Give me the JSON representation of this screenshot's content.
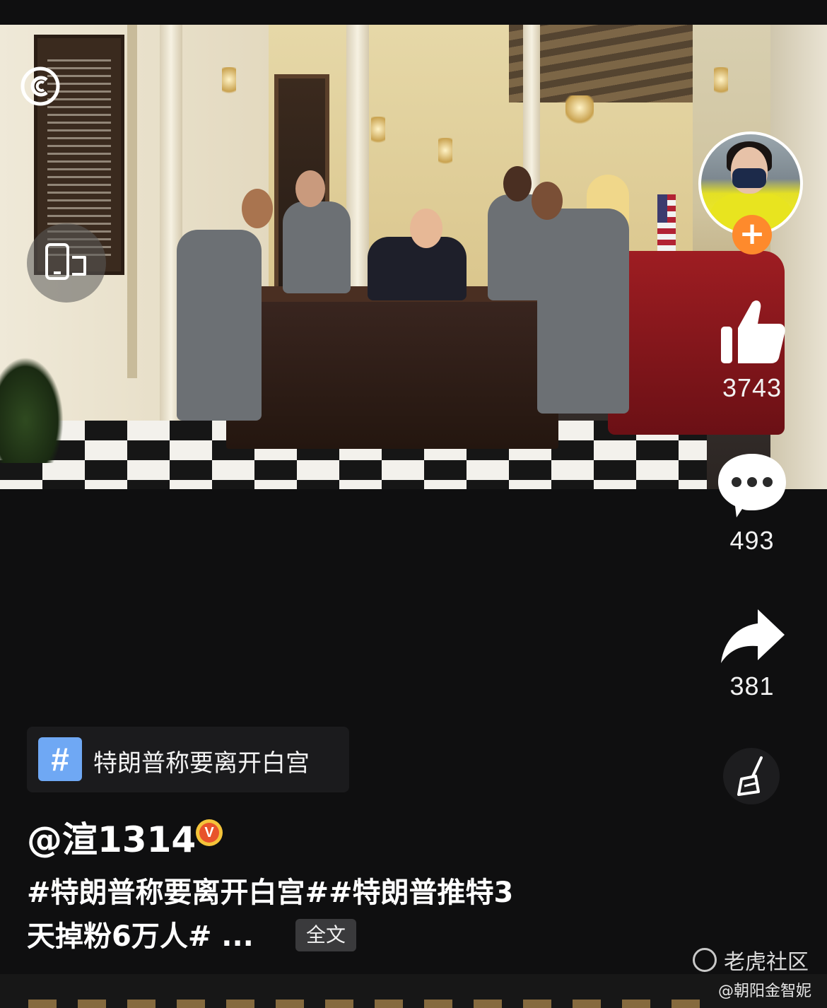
{
  "video": {
    "description_icon": "comedy-central-logo",
    "screen_toggle_icon": "phone-landscape-icon"
  },
  "creator": {
    "follow_icon": "plus-icon"
  },
  "actions": {
    "like": {
      "icon": "thumbs-up-icon",
      "count": "3743"
    },
    "comment": {
      "icon": "speech-bubble-icon",
      "count": "493"
    },
    "share": {
      "icon": "share-arrow-icon",
      "count": "381"
    },
    "clean": {
      "icon": "broom-icon"
    }
  },
  "topic": {
    "hash": "#",
    "label": "特朗普称要离开白宫"
  },
  "post": {
    "author": "@渲1314",
    "verified_badge": "V",
    "caption_line1": "#特朗普称要离开白宫##特朗普推特3",
    "caption_line2": "天掉粉6万人# ...",
    "full_text_button": "全文"
  },
  "watermark": {
    "brand": "老虎社区",
    "credit": "@朝阳金智妮"
  },
  "colors": {
    "background": "#0f0f10",
    "follow_accent": "#fe8a2c",
    "topic_hash_bg": "#6fa8f4",
    "badge_gold": "#f4c33a"
  }
}
